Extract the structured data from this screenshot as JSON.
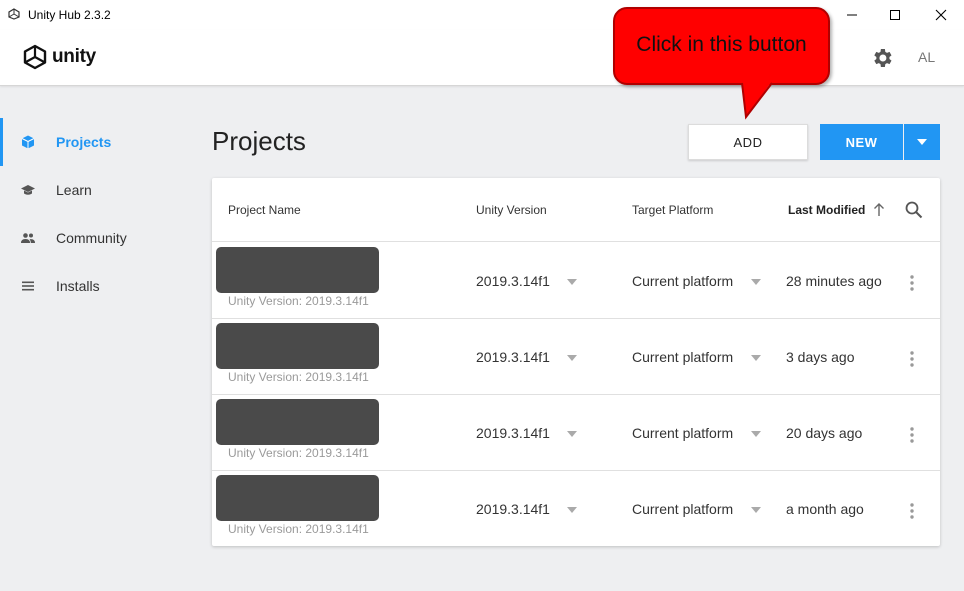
{
  "window": {
    "title": "Unity Hub 2.3.2"
  },
  "header": {
    "logo_text": "unity",
    "avatar_initials": "AL"
  },
  "sidebar": {
    "items": [
      {
        "label": "Projects",
        "icon": "cube-icon",
        "active": true
      },
      {
        "label": "Learn",
        "icon": "graduation-cap-icon",
        "active": false
      },
      {
        "label": "Community",
        "icon": "people-icon",
        "active": false
      },
      {
        "label": "Installs",
        "icon": "list-icon",
        "active": false
      }
    ]
  },
  "main": {
    "title": "Projects",
    "add_label": "ADD",
    "new_label": "NEW"
  },
  "callout": {
    "text": "Click in this button"
  },
  "table": {
    "columns": [
      "Project Name",
      "Unity Version",
      "Target Platform",
      "Last Modified"
    ],
    "rows": [
      {
        "subtitle": "Unity Version: 2019.3.14f1",
        "version": "2019.3.14f1",
        "platform": "Current platform",
        "modified": "28 minutes ago"
      },
      {
        "subtitle": "Unity Version: 2019.3.14f1",
        "version": "2019.3.14f1",
        "platform": "Current platform",
        "modified": "3 days ago"
      },
      {
        "subtitle": "Unity Version: 2019.3.14f1",
        "version": "2019.3.14f1",
        "platform": "Current platform",
        "modified": "20 days ago"
      },
      {
        "subtitle": "Unity Version: 2019.3.14f1",
        "version": "2019.3.14f1",
        "platform": "Current platform",
        "modified": "a month ago"
      }
    ]
  },
  "colors": {
    "accent": "#2196f3",
    "callout": "#ff0000",
    "redaction": "#4a4a4a"
  }
}
